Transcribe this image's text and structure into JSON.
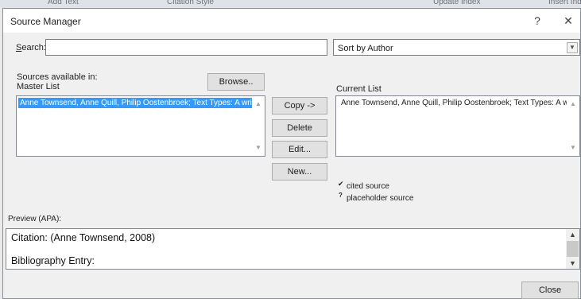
{
  "background_app": {
    "fragments": [
      "Add Text",
      "Citation Style",
      "Update Index",
      "Insert Index"
    ]
  },
  "dialog": {
    "title": "Source Manager",
    "help_glyph": "?",
    "close_glyph": "✕"
  },
  "search": {
    "label": "Search:",
    "value": ""
  },
  "sort": {
    "selected": "Sort by Author"
  },
  "sources": {
    "available_label": "Sources available in:",
    "master_label": "Master List",
    "current_label": "Current List",
    "browse_button": "Browse..",
    "master_items": [
      "Anne Townsend, Anne Quill, Philip Oostenbroek; Text Types: A writing guide"
    ],
    "current_items": [
      "Anne Townsend, Anne Quill, Philip Oostenbroek; Text Types: A writing guide"
    ]
  },
  "actions": {
    "copy": "Copy ->",
    "delete": "Delete",
    "edit": "Edit...",
    "new": "New..."
  },
  "legend": {
    "cited_glyph": "✔",
    "cited_label": "cited source",
    "placeholder_glyph": "?",
    "placeholder_label": "placeholder source"
  },
  "preview": {
    "label": "Preview (APA):",
    "citation": "Citation:  (Anne Townsend, 2008)",
    "bibliography": "Bibliography Entry:"
  },
  "footer": {
    "close": "Close"
  }
}
